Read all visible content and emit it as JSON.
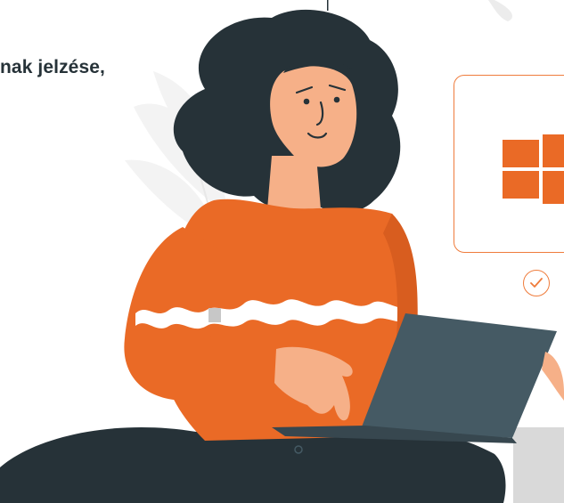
{
  "banner": {
    "text": "nak jelzése,"
  },
  "card": {
    "logo": "windows-logo",
    "status_icon": "check-circle-icon"
  },
  "colors": {
    "accent": "#ea6a26",
    "dark": "#263238",
    "skin": "#f6b088",
    "laptop": "#455a64",
    "leaf": "#f3f3f3"
  }
}
